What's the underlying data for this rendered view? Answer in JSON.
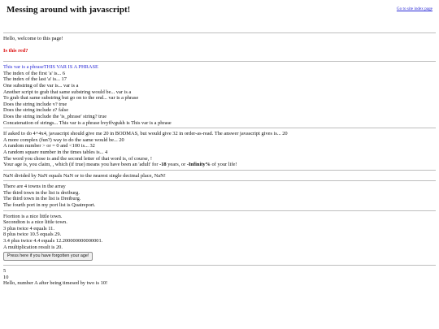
{
  "header": {
    "title": "Messing around with javascript!",
    "site_link": "Go to site index page"
  },
  "intro": {
    "welcome": "Hello, welcome to this page!",
    "red_question": "Is this red?"
  },
  "strings": {
    "line_blue": "This var is a phraseTHIS VAR IS A PHRASE",
    "lines": [
      "The index of the first 'a' is... 6",
      "The index of the last 'a' is... 17",
      "One substring of the var is... var is a",
      "Another script to grab that same substring would be... var is a",
      "To grab that same substring but go on to the end... var is a phrase",
      "Does the string include v? true",
      "Does the string include z? false",
      "Does the string include the 'is_phrase' string? true",
      "Concatenation of strings... This var is a phrase hvyffvgukh is This var is a phrase"
    ]
  },
  "math": {
    "lines": [
      "If asked to do 4+4x4, javascript should give me 20 in BODMAS, but would give 32 in order-as-read. The answer javascript gives is... 20",
      "A more complex (fun?) way to do the same would be... 20",
      "A random number > or = 0 and <100 is... 32",
      "A random square number in the times tables is... 4",
      "The word you chose is and the second letter of that word is, of course, !"
    ],
    "age": {
      "pre": "Your age is, you claim, , which (if true) means you have been an 'adult' for ",
      "years_value": "-18",
      "mid": " years, or ",
      "pct_value": "-Infinity%",
      "post": " of your life!"
    }
  },
  "nan": {
    "line": "NaN divided by NaN equals NaN or to the nearest single decimal place, NaN!"
  },
  "arrays": {
    "lines": [
      "There are 4 towns in the array",
      "The third town in the list is dreiburg.",
      "The third town in the list is Dreiburg.",
      "The fourth port in my port list is Quatreport."
    ]
  },
  "functions": {
    "lines": [
      "Fiortton is a nice little town.",
      "Secondton is a nice little town.",
      "3 plus twice 4 equals 11.",
      "8 plus twice 10.5 equals 29.",
      "3.4 plus twice 4.4 equals 12.200000000000001.",
      "A multiplication result is 20."
    ],
    "button_label": "Press here if you have forgotten your age!"
  },
  "results": {
    "lines": [
      "5",
      "10",
      "Hello, number A after being timesed by two is 10!"
    ]
  },
  "colors": {
    "red_text": "#dd1111",
    "blue_text": "#2a2ad6",
    "divider": "#bdbdbd"
  }
}
